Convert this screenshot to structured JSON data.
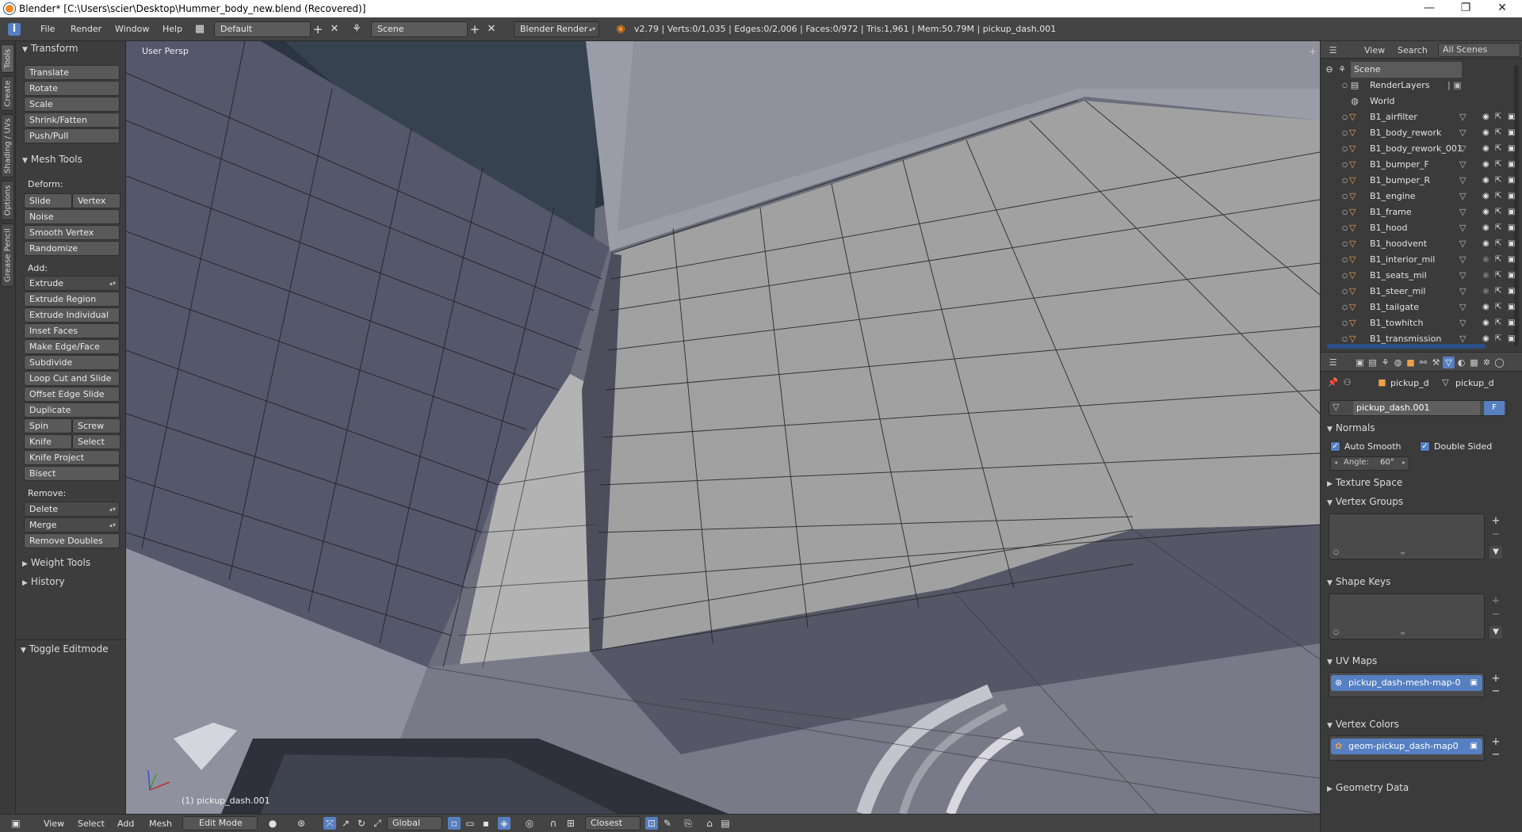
{
  "titlebar": {
    "title": "Blender* [C:\\Users\\scier\\Desktop\\Hummer_body_new.blend (Recovered)]",
    "minimize": "—",
    "restore": "❐",
    "close": "✕"
  },
  "infobar": {
    "menus": [
      "File",
      "Render",
      "Window",
      "Help"
    ],
    "layout": "Default",
    "scene": "Scene",
    "engine": "Blender Render",
    "stats": "v2.79 | Verts:0/1,035 | Edges:0/2,006 | Faces:0/972 | Tris:1,961 | Mem:50.79M | pickup_dash.001"
  },
  "lefttabs": [
    "Tools",
    "Create",
    "Shading / UVs",
    "Options",
    "Grease Pencil"
  ],
  "toolshelf": {
    "transform_head": "Transform",
    "transform": [
      "Translate",
      "Rotate",
      "Scale",
      "Shrink/Fatten",
      "Push/Pull"
    ],
    "meshtools_head": "Mesh Tools",
    "deform_label": "Deform:",
    "slide_edge": "Slide Edge",
    "vertex": "Vertex",
    "deform": [
      "Noise",
      "Smooth Vertex",
      "Randomize"
    ],
    "add_label": "Add:",
    "extrude": "Extrude",
    "add": [
      "Extrude Region",
      "Extrude Individual",
      "Inset Faces",
      "Make Edge/Face",
      "Subdivide",
      "Loop Cut and Slide",
      "Offset Edge Slide",
      "Duplicate"
    ],
    "spin": "Spin",
    "screw": "Screw",
    "knife": "Knife",
    "select": "Select",
    "knife_project": "Knife Project",
    "bisect": "Bisect",
    "remove_label": "Remove:",
    "delete": "Delete",
    "merge": "Merge",
    "remove_doubles": "Remove Doubles",
    "weight_tools": "Weight Tools",
    "history": "History",
    "toggle_editmode": "Toggle Editmode"
  },
  "viewport": {
    "view_label": "User Persp",
    "object_label": "(1) pickup_dash.001"
  },
  "bottombar": {
    "menus": [
      "View",
      "Select",
      "Add",
      "Mesh"
    ],
    "mode": "Edit Mode",
    "orientation": "Global",
    "snap": "Closest"
  },
  "outliner": {
    "view": "View",
    "search": "Search",
    "filter": "All Scenes",
    "scene": "Scene",
    "renderlayers": "RenderLayers",
    "world": "World",
    "objects": [
      "B1_airfilter",
      "B1_body_rework",
      "B1_body_rework_001",
      "B1_bumper_F",
      "B1_bumper_R",
      "B1_engine",
      "B1_frame",
      "B1_hood",
      "B1_hoodvent",
      "B1_interior_mil",
      "B1_seats_mil",
      "B1_steer_mil",
      "B1_tailgate",
      "B1_towhitch",
      "B1_transmission"
    ]
  },
  "properties": {
    "breadcrumb_obj": "pickup_d",
    "breadcrumb_mesh": "pickup_d",
    "mesh_name": "pickup_dash.001",
    "fake_user": "F",
    "normals": "Normals",
    "auto_smooth": "Auto Smooth",
    "double_sided": "Double Sided",
    "angle": "Angle:",
    "angle_value": "60°",
    "texture_space": "Texture Space",
    "vertex_groups": "Vertex Groups",
    "shape_keys": "Shape Keys",
    "uv_maps": "UV Maps",
    "uv_map_name": "pickup_dash-mesh-map-0",
    "vertex_colors": "Vertex Colors",
    "vcol_name": "geom-pickup_dash-map0",
    "geometry_data": "Geometry Data"
  }
}
